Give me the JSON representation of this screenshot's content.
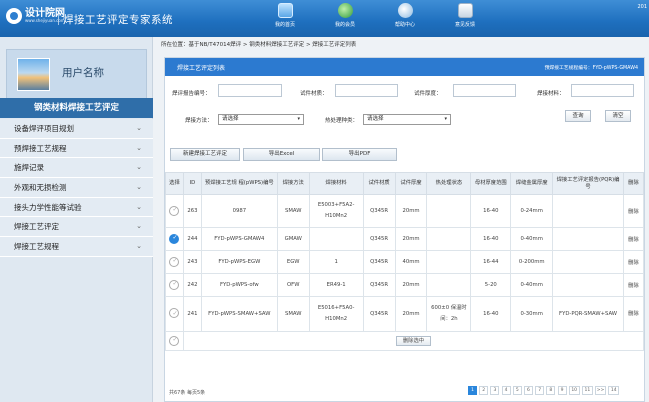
{
  "app": {
    "logo_cn": "设计院网",
    "logo_en": "www.shejiyuan.com",
    "title": "焊接工艺评定专家系统",
    "corner": "201"
  },
  "topnav": [
    {
      "label": "我的首页",
      "icon": "computer-icon"
    },
    {
      "label": "我的会员",
      "icon": "globe-icon"
    },
    {
      "label": "帮助中心",
      "icon": "magnifier-icon"
    },
    {
      "label": "意见反馈",
      "icon": "document-icon"
    }
  ],
  "sidebar": {
    "username": "用户名称",
    "section": "钢类材料焊接工艺评定",
    "items": [
      {
        "label": "设备焊评项目规划"
      },
      {
        "label": "预焊接工艺规程"
      },
      {
        "label": "施焊记录"
      },
      {
        "label": "外观和无损检测"
      },
      {
        "label": "接头力学性能等试验"
      },
      {
        "label": "焊接工艺评定"
      },
      {
        "label": "焊接工艺规程"
      }
    ]
  },
  "breadcrumb": "所在位置：基于NB/T47014焊评 > 钢类材料焊接工艺评定 > 焊接工艺评定列表",
  "panel": {
    "title": "焊接工艺评定列表",
    "right_text": "预焊接工艺规程编号：FYD-pWPS-GMAW4"
  },
  "filters": {
    "report_no_label": "焊评报告编号：",
    "material_label": "试件材质：",
    "thickness_label": "试件厚度：",
    "weld_material_label": "焊接材料：",
    "method_label": "焊接方法：",
    "method_value": "请选择",
    "heat_label": "热处理种类：",
    "heat_value": "请选择",
    "query_label": "查询",
    "clear_label": "清空"
  },
  "toolbar": {
    "new_label": "新建焊接工艺评定",
    "excel_label": "导出Excel",
    "pdf_label": "导出PDF"
  },
  "table": {
    "headers": [
      "选择",
      "ID",
      "预焊接工艺规 程(pWPS)编号",
      "焊接方法",
      "焊接材料",
      "试件材质",
      "试件厚度",
      "热处理状态",
      "母材厚度范围",
      "焊缝金属厚度",
      "焊接工艺评定报告(PQR)编号",
      "删除"
    ],
    "rows": [
      {
        "selected": false,
        "id": "263",
        "pwps": "0987",
        "method": "SMAW",
        "material": "E5003+F5A2-H10Mn2",
        "base": "Q345R",
        "thickness": "20mm",
        "heat": "",
        "range": "16-40",
        "weld": "0-24mm",
        "pqr": "",
        "del": "删除"
      },
      {
        "selected": true,
        "id": "244",
        "pwps": "FYD-pWPS-GMAW4",
        "method": "GMAW",
        "material": "",
        "base": "Q345R",
        "thickness": "20mm",
        "heat": "",
        "range": "16-40",
        "weld": "0-40mm",
        "pqr": "",
        "del": "删除"
      },
      {
        "selected": false,
        "id": "243",
        "pwps": "FYD-pWPS-EGW",
        "method": "EGW",
        "material": "1",
        "base": "Q345R",
        "thickness": "40mm",
        "heat": "",
        "range": "16-44",
        "weld": "0-200mm",
        "pqr": "",
        "del": "删除"
      },
      {
        "selected": false,
        "id": "242",
        "pwps": "FYD-pWPS-ofw",
        "method": "OFW",
        "material": "ER49-1",
        "base": "Q345R",
        "thickness": "20mm",
        "heat": "",
        "range": "5-20",
        "weld": "0-40mm",
        "pqr": "",
        "del": "删除"
      },
      {
        "selected": false,
        "id": "241",
        "pwps": "FYD-pWPS-SMAW+SAW",
        "method": "SMAW",
        "material": "E5016+F5A0-H10Mn2",
        "base": "Q345R",
        "thickness": "20mm",
        "heat": "600±0 保温时间：2h",
        "range": "16-40",
        "weld": "0-30mm",
        "pqr": "FYD-PQR-SMAW+SAW",
        "del": "删除"
      }
    ],
    "bulk_delete_label": "删除选中"
  },
  "footer": {
    "info": "共67条 每页5条",
    "pages": [
      "1",
      "2",
      "3",
      "4",
      "5",
      "6",
      "7",
      "8",
      "9",
      "10",
      "11",
      ">>",
      "14"
    ],
    "current_page": "1"
  },
  "colors": {
    "header_blue": "#1e6fbe",
    "panel_blue": "#2c7ad0",
    "sidebar_section": "#2f6ea9",
    "check_blue": "#2a86dc",
    "green_text": "#2f8f2f"
  }
}
